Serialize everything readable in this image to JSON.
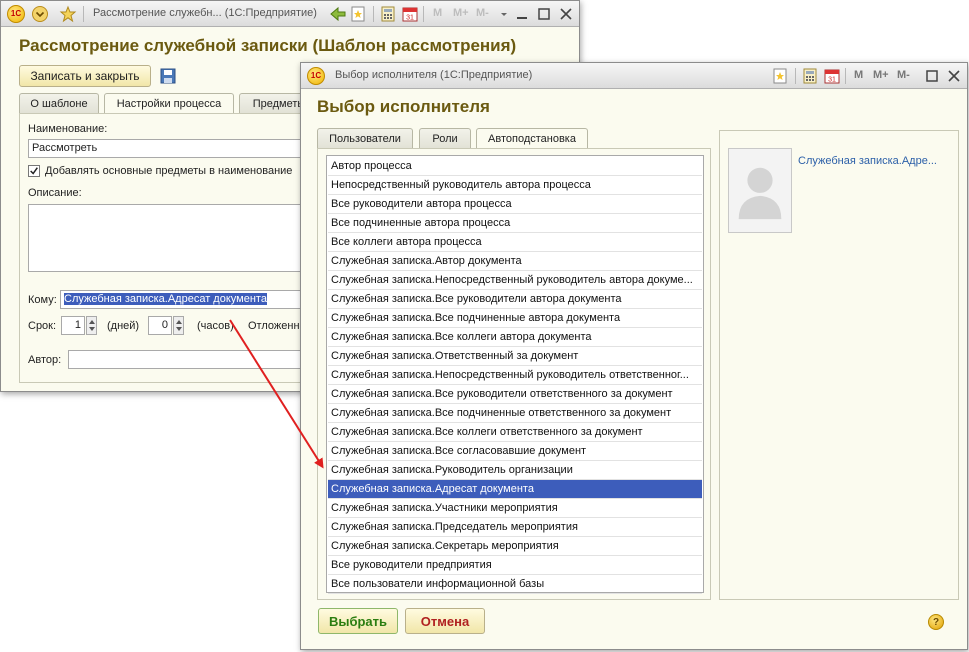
{
  "bg_window": {
    "title": "Рассмотрение служебн... (1С:Предприятие)",
    "heading": "Рассмотрение служебной записки (Шаблон рассмотрения)",
    "save_close_label": "Записать и закрыть",
    "tabs": [
      "О шаблоне",
      "Настройки процесса",
      "Предметы"
    ],
    "name_label": "Наименование:",
    "name_value": "Рассмотреть",
    "checkbox_label": "Добавлять основные предметы в наименование",
    "description_label": "Описание:",
    "to_label": "Кому:",
    "to_value": "Служебная записка.Адресат документа",
    "term_label": "Срок:",
    "days_value": "1",
    "days_label": "(дней)",
    "hours_value": "0",
    "hours_label": "(часов)",
    "postpone_label": "Отложенн",
    "author_label": "Автор:",
    "toolbar_m": [
      "M",
      "M+",
      "M-"
    ]
  },
  "fg_window": {
    "title": "Выбор исполнителя  (1С:Предприятие)",
    "heading": "Выбор исполнителя",
    "tabs": [
      "Пользователи",
      "Роли",
      "Автоподстановка"
    ],
    "items": [
      "Автор процесса",
      "Непосредственный руководитель автора процесса",
      "Все руководители автора процесса",
      "Все подчиненные автора процесса",
      "Все коллеги автора процесса",
      "Служебная записка.Автор документа",
      "Служебная записка.Непосредственный руководитель автора докуме...",
      "Служебная записка.Все руководители автора документа",
      "Служебная записка.Все подчиненные автора документа",
      "Служебная записка.Все коллеги автора документа",
      "Служебная записка.Ответственный за документ",
      "Служебная записка.Непосредственный руководитель ответственног...",
      "Служебная записка.Все руководители ответственного за документ",
      "Служебная записка.Все подчиненные ответственного за документ",
      "Служебная записка.Все коллеги ответственного за документ",
      "Служебная записка.Все согласовавшие документ",
      "Служебная записка.Руководитель организации",
      "Служебная записка.Адресат документа",
      "Служебная записка.Участники мероприятия",
      "Служебная записка.Председатель мероприятия",
      "Служебная записка.Секретарь мероприятия",
      "Все руководители предприятия",
      "Все пользователи информационной базы"
    ],
    "selected_index": 17,
    "preview_link": "Служебная записка.Адре...",
    "select_label": "Выбрать",
    "cancel_label": "Отмена",
    "help_label": "?",
    "toolbar_m": [
      "M",
      "M+",
      "M-"
    ]
  },
  "colors": {
    "accent": "#6b5a10",
    "selection": "#3d5dbb",
    "arrow": "#e02020",
    "select_button_text": "#2a7d10",
    "cancel_button_text": "#b02020"
  }
}
